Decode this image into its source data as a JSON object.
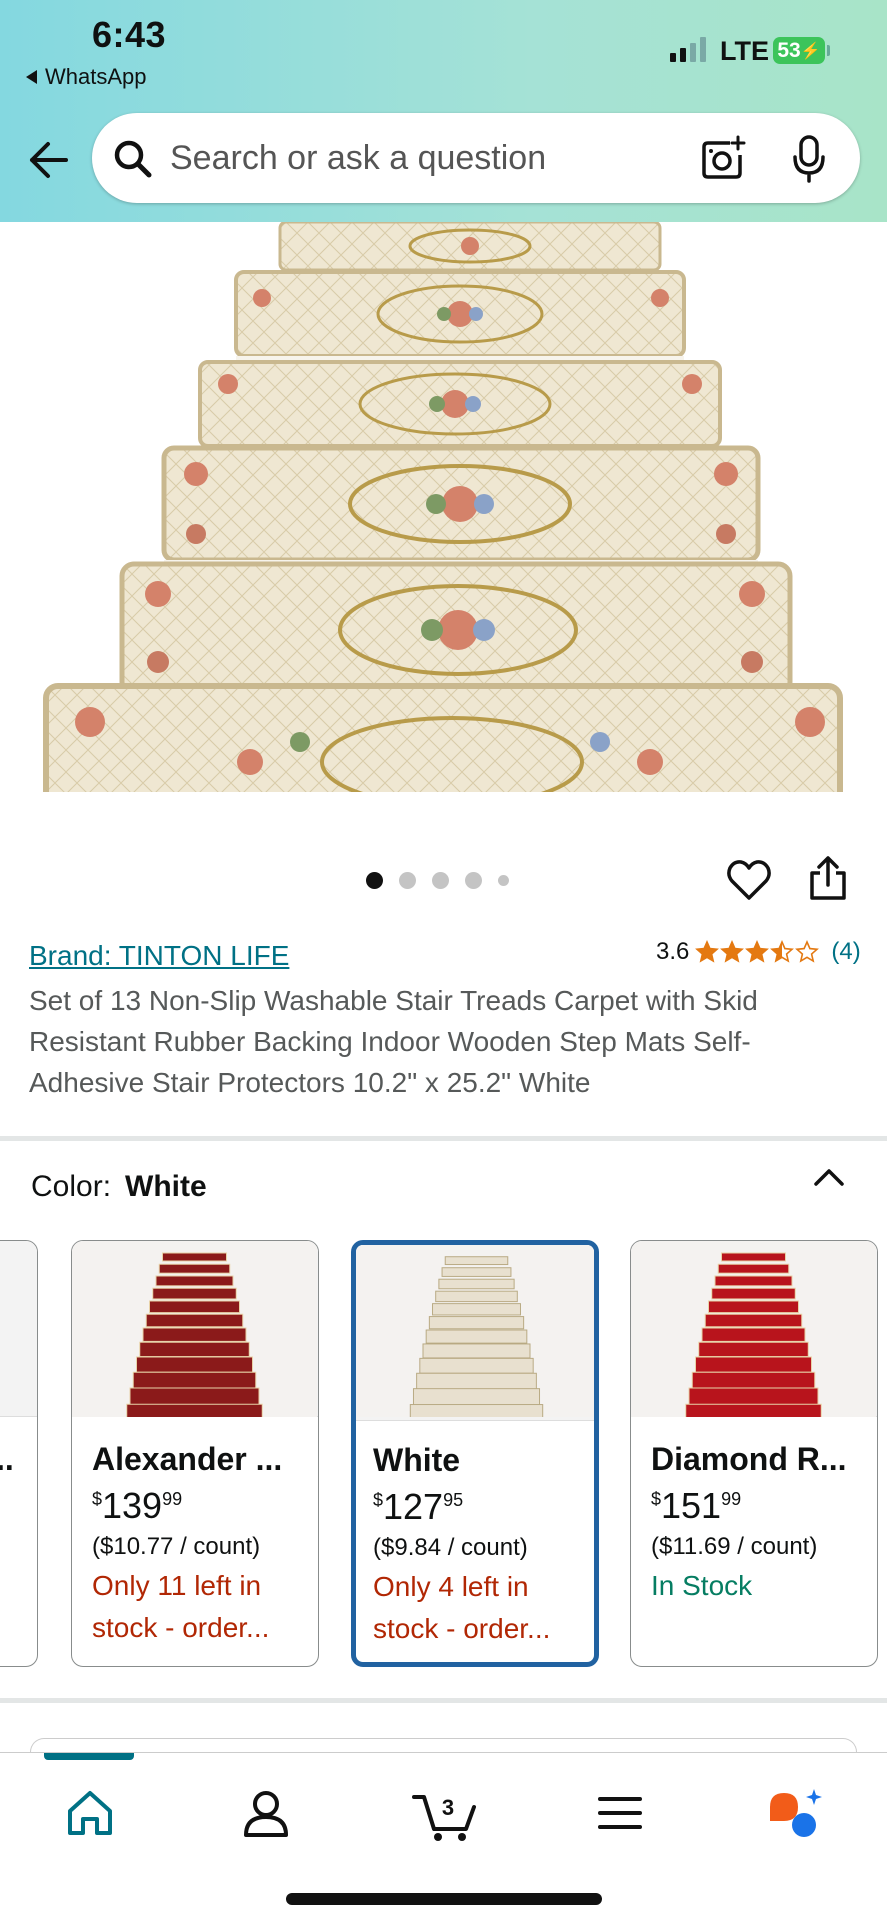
{
  "status_bar": {
    "time": "6:43",
    "back_app": "WhatsApp",
    "network": "LTE",
    "battery": "53"
  },
  "search": {
    "placeholder": "Search or ask a question"
  },
  "carousel": {
    "dots": 5,
    "active_index": 0
  },
  "product": {
    "brand": "Brand: TINTON LIFE",
    "rating": "3.6",
    "rating_value": 3.5,
    "review_count": "(4)",
    "title": "Set of 13 Non-Slip Washable Stair Treads Carpet with Skid Resistant Rubber Backing Indoor Wooden Step Mats Self-Adhesive Stair Protectors 10.2\" x 25.2\" White"
  },
  "color_selector": {
    "label": "Color:",
    "value": "White"
  },
  "variants": [
    {
      "name": "Alexander ...",
      "price_whole": "139",
      "price_fraction": "99",
      "currency": "$",
      "unit_price": "($10.77 / count)",
      "stock": "Only 11 left in stock - order...",
      "stock_status": "low",
      "swatch": "#8b1a1a"
    },
    {
      "name": "White",
      "price_whole": "127",
      "price_fraction": "95",
      "currency": "$",
      "unit_price": "($9.84 / count)",
      "stock": "Only 4 left in stock - order...",
      "stock_status": "low",
      "swatch": "#e8e0cf",
      "selected": true
    },
    {
      "name": "Diamond R...",
      "price_whole": "151",
      "price_fraction": "99",
      "currency": "$",
      "unit_price": "($11.69 / count)",
      "stock": "In Stock",
      "stock_status": "in",
      "swatch": "#b8141c"
    }
  ],
  "bottom_nav": {
    "cart_count": "3",
    "items": [
      "home",
      "account",
      "cart",
      "menu",
      "rufus"
    ]
  },
  "colors": {
    "link": "#007185",
    "selected_border": "#2162a1",
    "low_stock": "#b12704",
    "in_stock": "#067d62",
    "star": "#e47911"
  }
}
